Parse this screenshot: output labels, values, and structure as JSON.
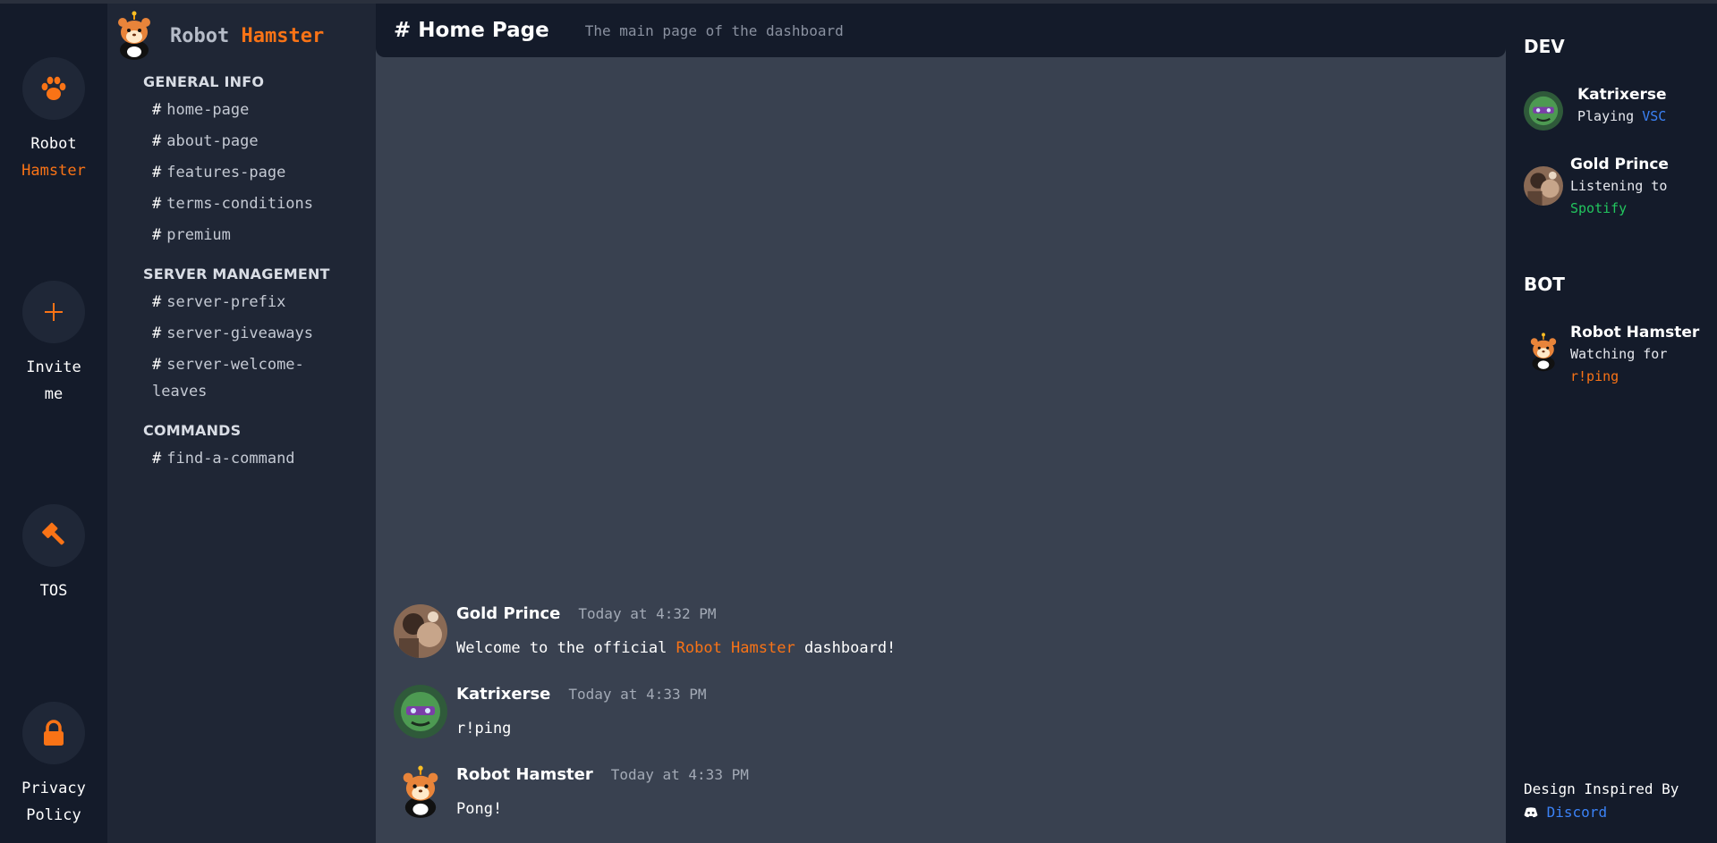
{
  "rail": {
    "robot": {
      "line1": "Robot",
      "line2": "Hamster",
      "icon": "paw-icon"
    },
    "invite": {
      "line1": "Invite",
      "line2": "me",
      "icon": "plus-icon"
    },
    "tos": {
      "line1": "TOS",
      "icon": "gavel-icon"
    },
    "privacy": {
      "line1": "Privacy",
      "line2": "Policy",
      "icon": "lock-icon"
    }
  },
  "brand": {
    "name_part1": "Robot",
    "name_part2": "Hamster"
  },
  "groups": [
    {
      "title": "GENERAL INFO",
      "channels": [
        "home-page",
        "about-page",
        "features-page",
        "terms-conditions",
        "premium"
      ]
    },
    {
      "title": "SERVER MANAGEMENT",
      "channels": [
        "server-prefix",
        "server-giveaways",
        "server-welcome-leaves"
      ]
    },
    {
      "title": "COMMANDS",
      "channels": [
        "find-a-command"
      ]
    }
  ],
  "channel_hash": "#",
  "header": {
    "title": "# Home Page",
    "description": "The main page of the dashboard"
  },
  "messages": [
    {
      "author": "Gold Prince",
      "time": "Today at 4:32 PM",
      "text_before": "Welcome to the official ",
      "text_accent": "Robot Hamster",
      "text_after": " dashboard!"
    },
    {
      "author": "Katrixerse",
      "time": "Today at 4:33 PM",
      "text": "r!ping"
    },
    {
      "author": "Robot Hamster",
      "time": "Today at 4:33 PM",
      "text": "Pong!"
    }
  ],
  "members": {
    "dev_title": "DEV",
    "bot_title": "BOT",
    "dev": [
      {
        "name": "Katrixerse",
        "status_prefix": "Playing ",
        "status_value": "VSC"
      },
      {
        "name": "Gold Prince",
        "status_prefix": "Listening to",
        "status_value": "Spotify"
      }
    ],
    "bot": [
      {
        "name": "Robot Hamster",
        "status_prefix": "Watching for",
        "status_value": "r!ping"
      }
    ]
  },
  "credit": {
    "line1": "Design Inspired By",
    "link": "Discord",
    "icon": "discord-icon"
  },
  "colors": {
    "accent": "#f97316",
    "link_blue": "#3b82f6",
    "spotify_green": "#22c55e",
    "rail_bg": "#141b2a",
    "sidebar_bg": "#1f2635",
    "main_bg": "#394150"
  }
}
